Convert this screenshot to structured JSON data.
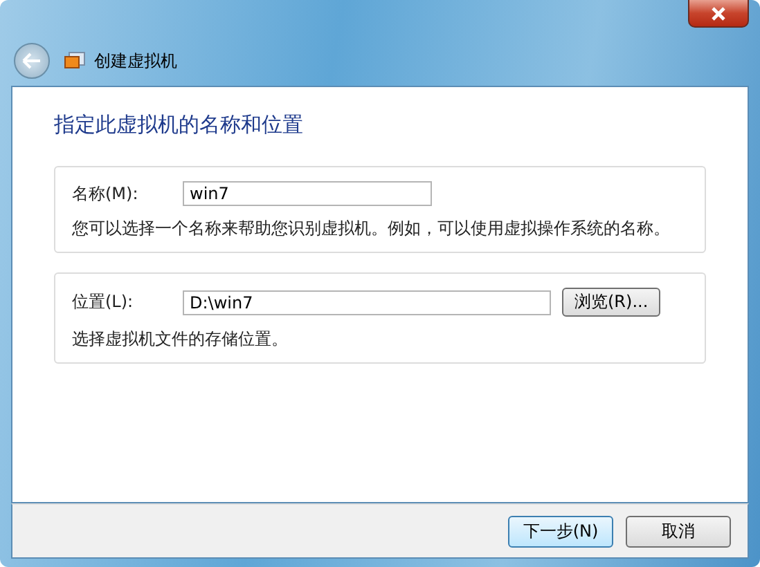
{
  "window": {
    "title": "创建虚拟机"
  },
  "heading": "指定此虚拟机的名称和位置",
  "name_group": {
    "label": "名称(M):",
    "value": "win7",
    "hint": "您可以选择一个名称来帮助您识别虚拟机。例如，可以使用虚拟操作系统的名称。"
  },
  "location_group": {
    "label": "位置(L):",
    "value": "D:\\win7",
    "browse": "浏览(R)...",
    "hint": "选择虚拟机文件的存储位置。"
  },
  "buttons": [
    {
      "label": "下一步(N)",
      "selected": true
    },
    {
      "label": "取消",
      "selected": false
    }
  ]
}
